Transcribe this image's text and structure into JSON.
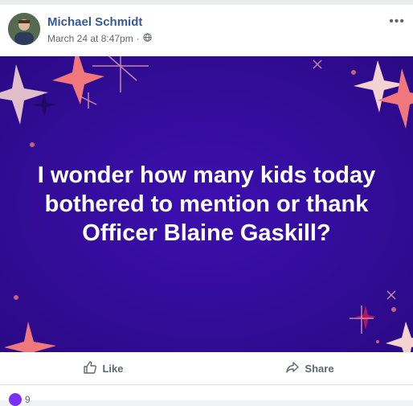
{
  "post": {
    "author": "Michael Schmidt",
    "timestamp": "March 24 at 8:47pm",
    "privacy_icon": "globe-icon",
    "menu_icon": "more-icon",
    "quote": "I wonder how many kids today bothered to mention or thank Officer Blaine Gaskill?",
    "background_color": "#3a0ca3",
    "star_colors": [
      "#f0777b",
      "#e9a6a6",
      "#f3d2cf",
      "#c2185b"
    ]
  },
  "actions": {
    "like_label": "Like",
    "share_label": "Share",
    "like_icon": "thumbs-up-icon",
    "share_icon": "share-arrow-icon"
  },
  "reactions": {
    "count": "9"
  }
}
